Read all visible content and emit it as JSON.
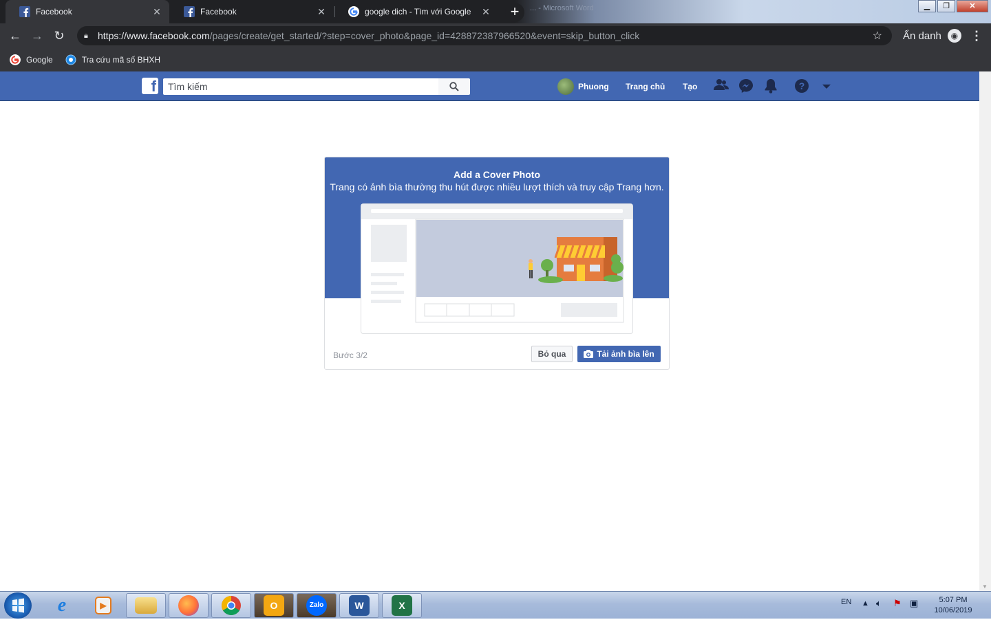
{
  "tabs": [
    {
      "title": "Facebook",
      "close": "✕"
    },
    {
      "title": "Facebook",
      "close": "✕"
    },
    {
      "title": "google dich - Tìm với Google",
      "close": "✕"
    }
  ],
  "window_title_faint": "... - Microsoft Word",
  "address": {
    "host": "https://www.facebook.com",
    "path": "/pages/create/get_started/?step=cover_photo&page_id=428872387966520&event=skip_button_click"
  },
  "incognito_label": "Ẩn danh",
  "bookmarks": [
    {
      "label": "Google"
    },
    {
      "label": "Tra cứu mã số BHXH"
    }
  ],
  "facebook": {
    "search_placeholder": "Tìm kiếm",
    "user_name": "Phuong",
    "nav_home": "Trang chủ",
    "nav_create": "Tạo"
  },
  "card": {
    "title": "Add a Cover Photo",
    "subtitle": "Trang có ảnh bìa thường thu hút được nhiều lượt thích và truy cập Trang hơn.",
    "step": "Bước 3/2",
    "skip_label": "Bỏ qua",
    "upload_label": "Tải ảnh bìa lên"
  },
  "taskbar": {
    "language": "EN",
    "time": "5:07 PM",
    "date": "10/06/2019",
    "apps": [
      "internet-explorer",
      "media-player",
      "file-explorer",
      "firefox",
      "chrome",
      "outlook",
      "zalo",
      "word",
      "excel"
    ]
  },
  "colors": {
    "facebook_blue": "#4267b2",
    "chrome_dark": "#35363a",
    "chrome_tab_bg": "#202124"
  }
}
